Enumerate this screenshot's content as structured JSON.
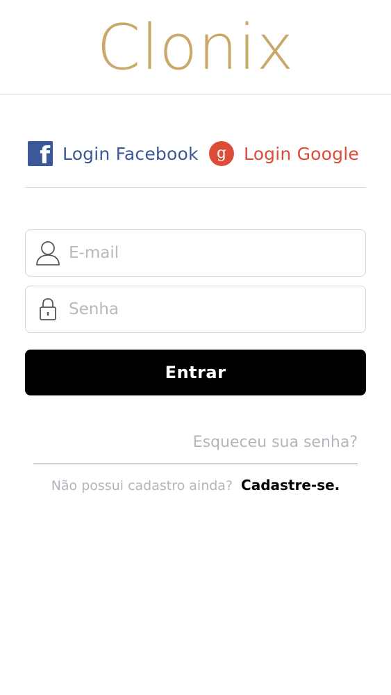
{
  "app": {
    "logo_text": "Clonix",
    "logo_color": "#c9a86a"
  },
  "social": {
    "facebook": {
      "label": "Login Facebook",
      "icon": "facebook-icon",
      "color": "#3b5998"
    },
    "google": {
      "label": "Login Google",
      "icon": "google-plus-icon",
      "color": "#dd4b39"
    }
  },
  "form": {
    "email": {
      "placeholder": "E-mail",
      "value": "",
      "icon": "user-icon"
    },
    "password": {
      "placeholder": "Senha",
      "value": "",
      "icon": "lock-icon"
    },
    "submit_label": "Entrar"
  },
  "links": {
    "forgot_password": "Esqueceu sua senha?",
    "no_account_question": "Não possui cadastro ainda?",
    "signup": "Cadastre-se."
  }
}
